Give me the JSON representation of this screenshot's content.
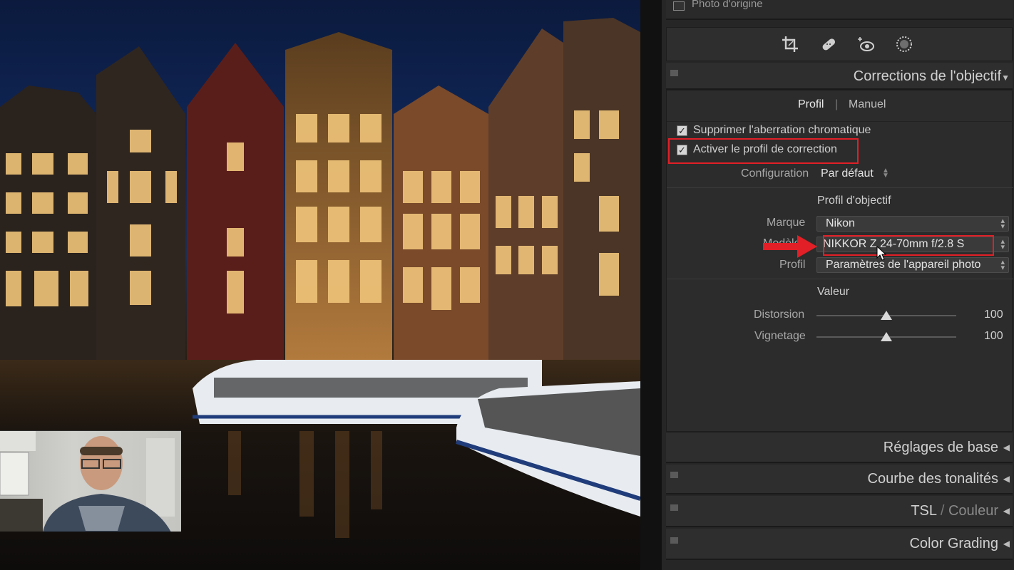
{
  "panel": {
    "photo_origin_label": "Photo d'origine",
    "tools": [
      {
        "icon": "crop-icon"
      },
      {
        "icon": "healing-icon"
      },
      {
        "icon": "red-eye-icon"
      },
      {
        "icon": "mask-icon"
      }
    ],
    "lens_corrections": {
      "title": "Corrections de l'objectif",
      "tabs": {
        "profil": "Profil",
        "separator": "|",
        "manuel": "Manuel"
      },
      "remove_ca_label": "Supprimer l'aberration chromatique",
      "remove_ca_checked": true,
      "enable_profile_label": "Activer le profil de correction",
      "enable_profile_checked": true,
      "configuration_label": "Configuration",
      "configuration_value": "Par défaut",
      "lens_profile_heading": "Profil d'objectif",
      "make_label": "Marque",
      "make_value": "Nikon",
      "model_label": "Modèle",
      "model_value": "NIKKOR Z 24-70mm f/2.8 S",
      "profile_label": "Profil",
      "profile_value": "Paramètres de l'appareil photo",
      "amount_heading": "Valeur",
      "distortion_label": "Distorsion",
      "distortion_value": "100",
      "vignetting_label": "Vignetage",
      "vignetting_value": "100",
      "distortion_fraction": 0.5,
      "vignetting_fraction": 0.5
    },
    "sections": {
      "basic": "Réglages de base",
      "tone_curve": "Courbe des tonalités",
      "hsl_a": "TSL",
      "hsl_sep": " / ",
      "hsl_b": "Couleur",
      "color_grading": "Color Grading"
    }
  },
  "colors": {
    "highlight_red": "#e21f26",
    "panel_bg": "#262626"
  }
}
